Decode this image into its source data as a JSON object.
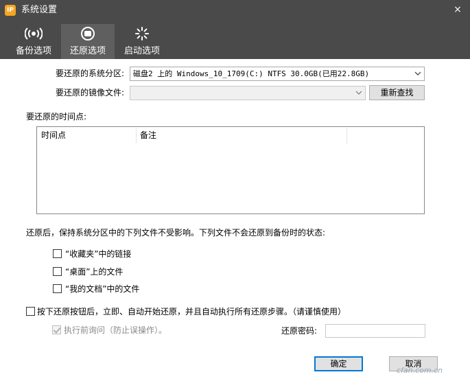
{
  "window": {
    "title": "系统设置",
    "app_icon_text": "IP",
    "close_glyph": "×"
  },
  "tabs": [
    {
      "label": "备份选项",
      "icon": "backup-radio-icon",
      "active": false
    },
    {
      "label": "还原选项",
      "icon": "restore-circle-icon",
      "active": true
    },
    {
      "label": "启动选项",
      "icon": "startup-spinner-icon",
      "active": false
    }
  ],
  "form": {
    "partition_label": "要还原的系统分区:",
    "partition_value": "磁盘2 上的 Windows_10_1709(C:) NTFS 30.0GB(已用22.8GB)",
    "image_label": "要还原的镜像文件:",
    "image_value": "",
    "rescan_label": "重新查找",
    "timepoint_label": "要还原的时间点:",
    "columns": [
      "时间点",
      "备注"
    ]
  },
  "keep_files": {
    "intro": "还原后，保持系统分区中的下列文件不受影响。下列文件不会还原到备份时的状态:",
    "options": [
      "“收藏夹”中的链接",
      "“桌面”上的文件",
      "“我的文档”中的文件"
    ]
  },
  "auto_restore": {
    "label": "按下还原按钮后，立即、自动开始还原，并且自动执行所有还原步骤。（请谨慎使用）",
    "confirm_label": "执行前询问（防止误操作）。",
    "password_label": "还原密码:",
    "password_value": ""
  },
  "buttons": {
    "ok": "确定",
    "cancel": "取消"
  },
  "watermark": "cfan.com.cn",
  "colors": {
    "header_bg": "#4a4a4a",
    "active_tab_bg": "#5f5f5f",
    "default_button_border": "#0078d7"
  }
}
